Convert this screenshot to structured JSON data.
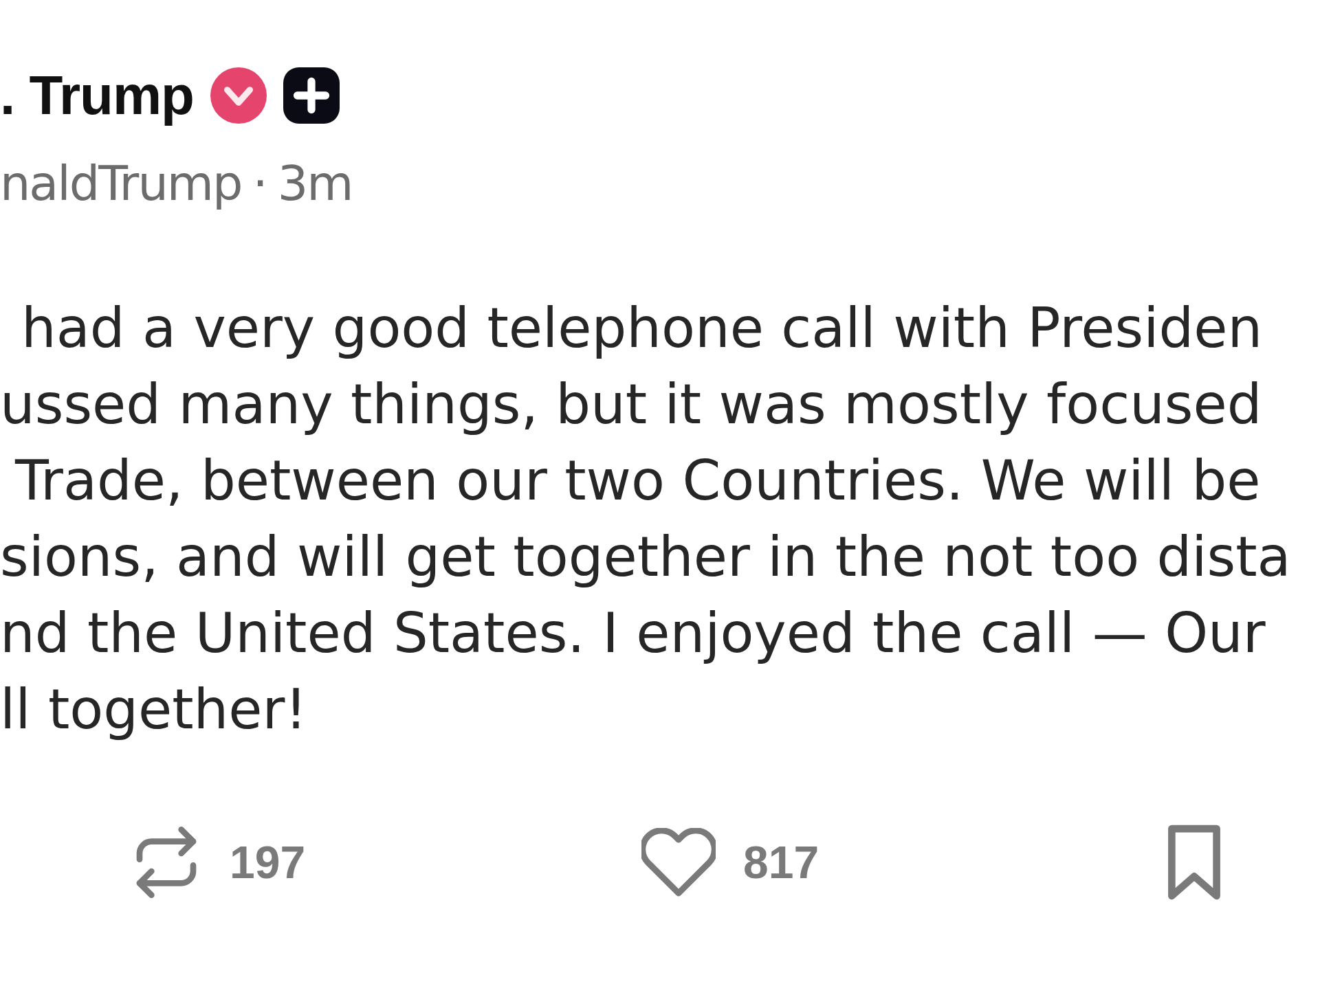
{
  "post": {
    "author_name": ". Trump",
    "badges": [
      {
        "kind": "verified"
      },
      {
        "kind": "plus"
      }
    ],
    "handle": "naldTrump",
    "separator": "·",
    "time": "3m",
    "body_lines": [
      "had a very good telephone call with Presiden",
      "ussed many things, but it was mostly focused",
      "Trade, between our two Countries. We will be",
      "sions, and will get together in the not too dista",
      "nd the United States. I enjoyed the call — Our",
      "ll together!"
    ],
    "actions": [
      {
        "kind": "repost",
        "count": "197"
      },
      {
        "kind": "like",
        "count": "817"
      },
      {
        "kind": "bookmark"
      }
    ]
  }
}
